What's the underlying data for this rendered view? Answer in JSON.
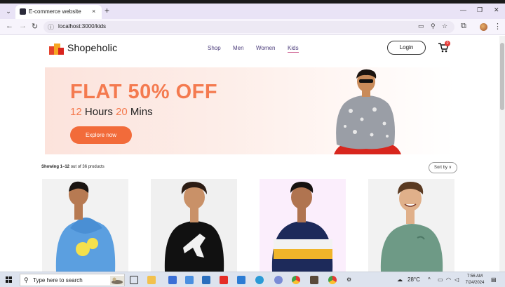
{
  "browser": {
    "tab_title": "E-commerce website",
    "tab_close": "×",
    "new_tab": "+",
    "url": "localhost:3000/kids",
    "nav_icons": [
      "arrow-left-icon",
      "arrow-right-icon",
      "reload-icon",
      "info-icon"
    ],
    "right_icons": [
      "cast-icon",
      "zoom-icon",
      "star-icon",
      "extensions-icon",
      "profile-avatar",
      "menu-icon"
    ],
    "window_controls": [
      "minimize-icon",
      "restore-icon",
      "close-icon"
    ]
  },
  "header": {
    "logo_text": "Shopeholic",
    "nav": [
      {
        "label": "Shop",
        "active": false
      },
      {
        "label": "Men",
        "active": false
      },
      {
        "label": "Women",
        "active": false
      },
      {
        "label": "Kids",
        "active": true
      }
    ],
    "login_label": "Login",
    "cart_count": "0"
  },
  "banner": {
    "headline": "FLAT 50% OFF",
    "hours_num": "12",
    "hours_label": "Hours",
    "mins_num": "20",
    "mins_label": "Mins",
    "button_label": "Explore now"
  },
  "listing": {
    "showing_range": "Showing 1–12",
    "showing_rest": "out of 36 products",
    "sort_label": "Sort by ∨"
  },
  "products": [
    {
      "name": "blue-hoodie-kid",
      "bg": "#f2f2f2",
      "shirt": "#5b9fe0"
    },
    {
      "name": "black-hoodie-kid",
      "bg": "#f0f0f0",
      "shirt": "#111111"
    },
    {
      "name": "striped-hoodie-kid",
      "bg": "#fbeefc",
      "shirt": "#1d2a5a"
    },
    {
      "name": "green-sweater-kid",
      "bg": "#f2f2f2",
      "shirt": "#6e9a86"
    }
  ],
  "taskbar": {
    "search_placeholder": "Type here to search",
    "weather": "28°C",
    "time": "7:56 AM",
    "date": "7/24/2024"
  },
  "colors": {
    "accent_orange": "#f26b3a",
    "nav_text": "#4a3b7a",
    "active_underline": "#c94f86",
    "cart_badge": "#e53935"
  }
}
